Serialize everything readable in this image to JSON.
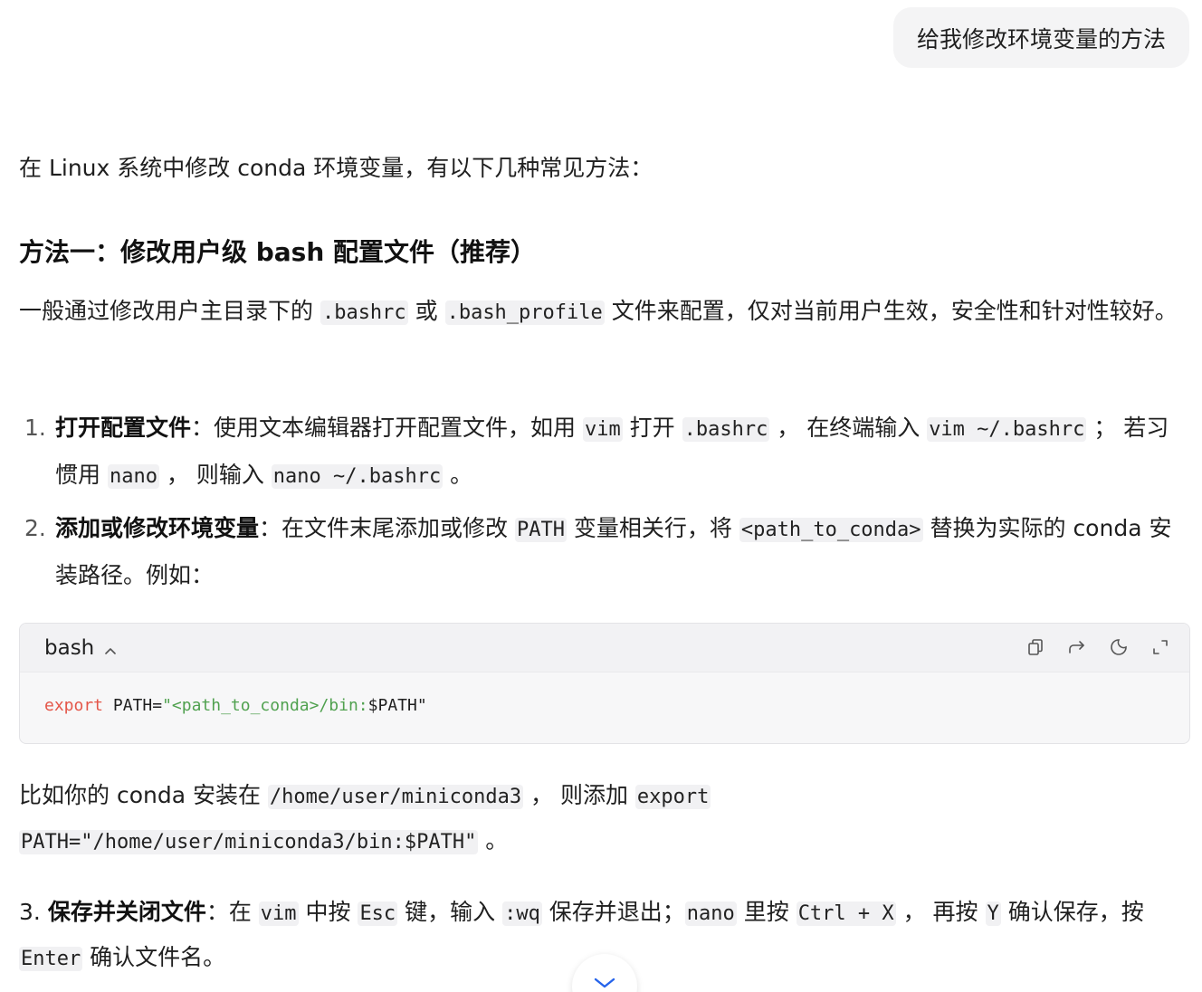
{
  "user_message": "给我修改环境变量的方法",
  "intro": "在 Linux 系统中修改 conda 环境变量，有以下几种常见方法：",
  "method1": {
    "title": "方法一：修改用户级 bash 配置文件（推荐）",
    "desc_1": "一般通过修改用户主目录下的 ",
    "desc_code_1": ".bashrc",
    "desc_2": " 或 ",
    "desc_code_2": ".bash_profile",
    "desc_3": " 文件来配置，仅对当前用户生效，安全性和针对性较好。"
  },
  "step1": {
    "num": "1.",
    "title": "打开配置文件",
    "t1": "：使用文本编辑器打开配置文件，如用 ",
    "c1": "vim",
    "t2": " 打开 ",
    "c2": ".bashrc",
    "t3": " ， 在终端输入 ",
    "c3": "vim ~/.bashrc",
    "t4": " ； 若习惯用 ",
    "c4": "nano",
    "t5": " ， 则输入 ",
    "c5": "nano ~/.bashrc",
    "t6": " 。"
  },
  "step2": {
    "num": "2.",
    "title": "添加或修改环境变量",
    "t1": "：在文件末尾添加或修改 ",
    "c1": "PATH",
    "t2": " 变量相关行，将 ",
    "c2": "<path_to_conda>",
    "t3": " 替换为实际的 conda 安装路径。例如："
  },
  "code_block": {
    "language": "bash",
    "keyword": "export",
    "var": " PATH=",
    "string": "\"<path_to_conda>/bin:",
    "var_ref": "$PATH",
    "quote_end": "\""
  },
  "example": {
    "t1": "比如你的 conda 安装在 ",
    "c1": "/home/user/miniconda3",
    "t2": " ， 则添加 ",
    "c2a": "export",
    "c2b": "PATH=\"/home/user/miniconda3/bin:$PATH\"",
    "t3": " 。"
  },
  "step3": {
    "num": "3.",
    "title": "保存并关闭文件",
    "t1": "：在 ",
    "c1": "vim",
    "t2": " 中按 ",
    "c2": "Esc",
    "t3": " 键，输入 ",
    "c3": ":wq",
    "t4": " 保存并退出；",
    "c4": "nano",
    "t5": " 里按 ",
    "c5": "Ctrl + X",
    "t6": " ， 再按 ",
    "c6": "Y",
    "t7": " 确认保存，按 ",
    "c7": "Enter",
    "t8": " 确认文件名。"
  },
  "icons": [
    "copy-icon",
    "share-icon",
    "theme-icon",
    "expand-icon",
    "chevron-up-icon",
    "chevron-down-icon"
  ]
}
